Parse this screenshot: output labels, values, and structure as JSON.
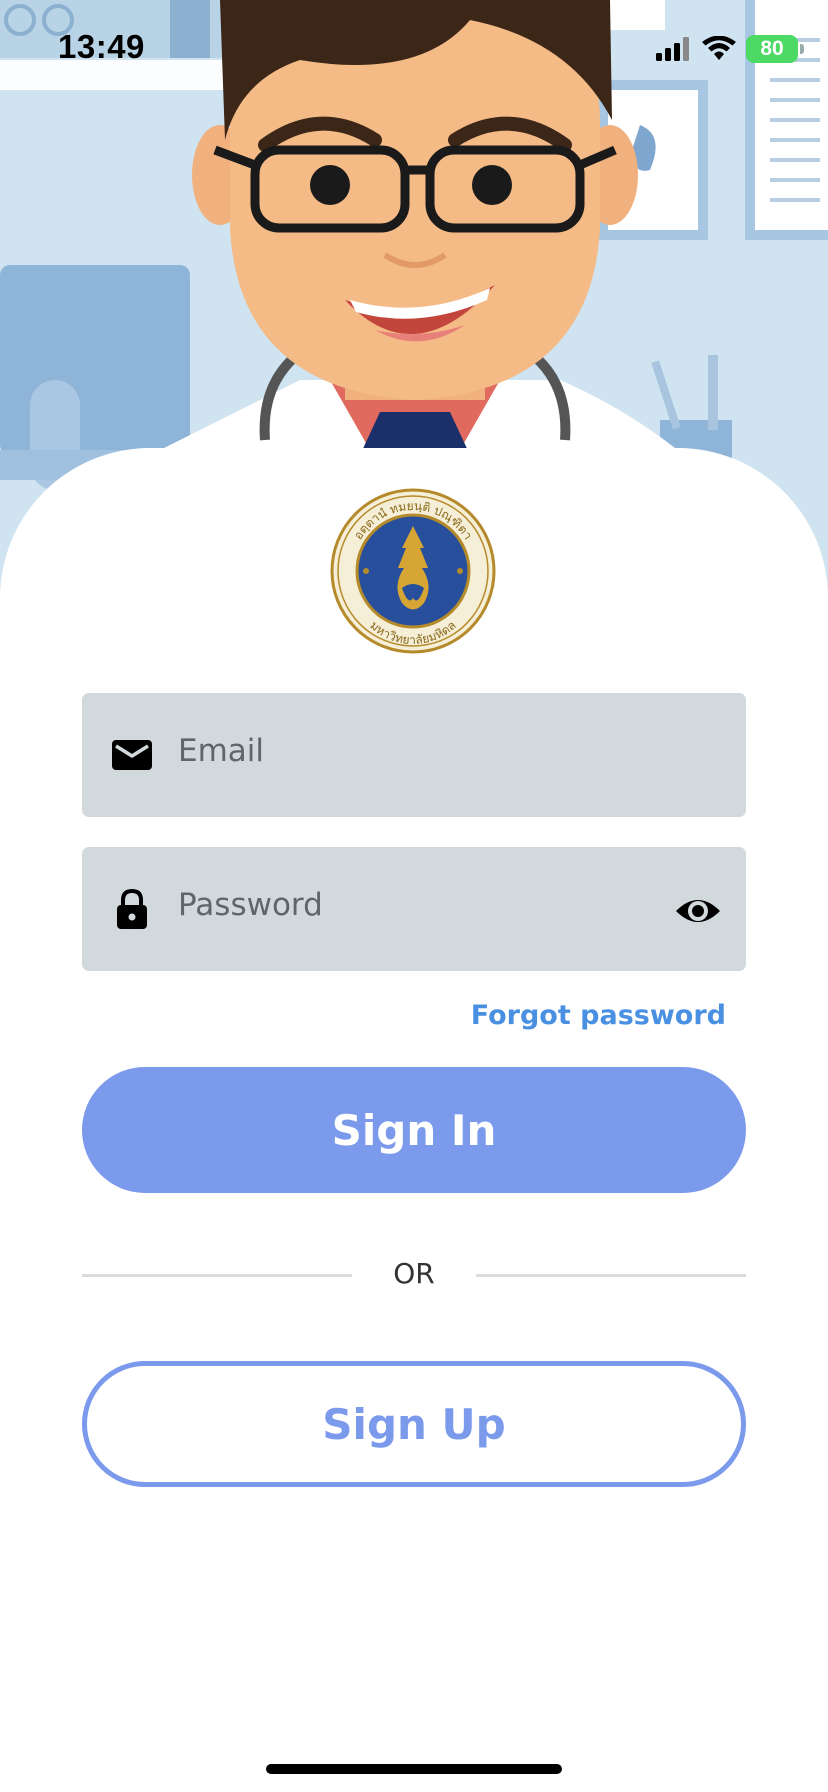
{
  "status_bar": {
    "time": "13:49",
    "battery": "80",
    "icons": [
      "signal-icon",
      "wifi-icon",
      "battery-icon"
    ]
  },
  "hero": {
    "illustration": "cartoon doctor with glasses and stethoscope in clinic"
  },
  "logo": {
    "name": "mahidol-university-seal",
    "text_top": "อตฺตานํ ทมยนฺติ ปณฺฑิตา",
    "text_bottom": "มหาวิทยาลัยมหิดล"
  },
  "form": {
    "email_placeholder": "Email",
    "email_icon": "mail-icon",
    "password_placeholder": "Password",
    "password_icon": "lock-icon",
    "toggle_icon": "eye-icon",
    "forgot_password": "Forgot password"
  },
  "actions": {
    "sign_in": "Sign In",
    "divider": "OR",
    "sign_up": "Sign Up"
  },
  "colors": {
    "accent": "#7b9aec",
    "link": "#4a90e2",
    "field_bg": "#d2d9dd",
    "battery": "#4cd964",
    "hero_bg": "#cfe3f0"
  }
}
